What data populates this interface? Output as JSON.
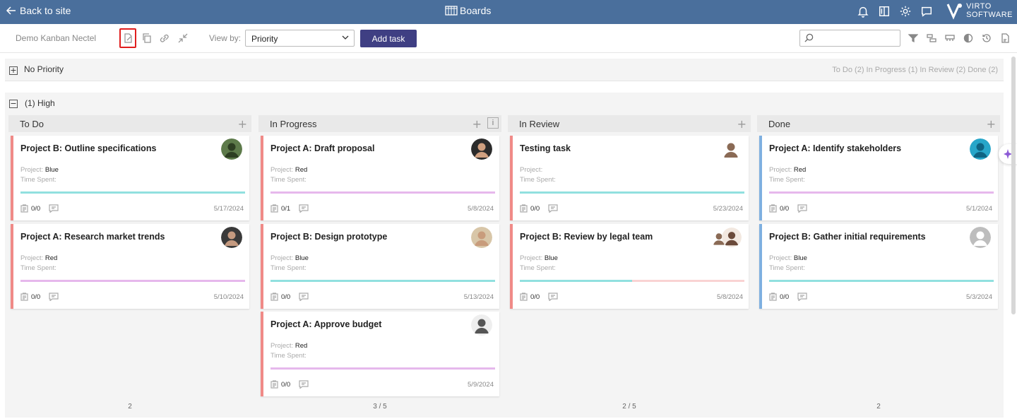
{
  "topbar": {
    "back_label": "Back to site",
    "title": "Boards",
    "icons": [
      "bell-icon",
      "book-icon",
      "gear-icon",
      "feedback-icon"
    ],
    "logo_line1": "VIRTO",
    "logo_line2": "SOFTWARE"
  },
  "toolbar": {
    "board_name": "Demo Kanban Nectel",
    "viewby_label": "View by:",
    "viewby_value": "Priority",
    "add_task_label": "Add task",
    "search_placeholder": ""
  },
  "lanes": [
    {
      "title": "No Priority",
      "summary": "To Do (2)  In Progress (1)  In Review (2)  Done (2)",
      "collapsed": true
    },
    {
      "title": "(1) High",
      "collapsed": false
    }
  ],
  "columns": [
    {
      "title": "To Do",
      "count": "2",
      "cards": [
        {
          "title": "Project B: Outline specifications",
          "project_label": "Project:",
          "project": "Blue",
          "time_label": "Time Spent:",
          "checklist": "0/0",
          "date": "5/17/2024"
        },
        {
          "title": "Project A: Research market trends",
          "project_label": "Project:",
          "project": "Red",
          "time_label": "Time Spent:",
          "checklist": "0/0",
          "date": "5/10/2024"
        }
      ]
    },
    {
      "title": "In Progress",
      "count": "3  /  5",
      "cards": [
        {
          "title": "Project A: Draft proposal",
          "project_label": "Project:",
          "project": "Red",
          "time_label": "Time Spent:",
          "checklist": "0/1",
          "date": "5/8/2024"
        },
        {
          "title": "Project B: Design prototype",
          "project_label": "Project:",
          "project": "Blue",
          "time_label": "Time Spent:",
          "checklist": "0/0",
          "date": "5/13/2024"
        },
        {
          "title": "Project A: Approve budget",
          "project_label": "Project:",
          "project": "Red",
          "time_label": "Time Spent:",
          "checklist": "0/0",
          "date": "5/9/2024"
        }
      ]
    },
    {
      "title": "In Review",
      "count": "2  /  5",
      "cards": [
        {
          "title": "Testing task",
          "project_label": "Project:",
          "project": "",
          "time_label": "Time Spent:",
          "checklist": "0/0",
          "date": "5/23/2024"
        },
        {
          "title": "Project B: Review by legal team",
          "project_label": "Project:",
          "project": "Blue",
          "time_label": "Time Spent:",
          "checklist": "0/0",
          "date": "5/8/2024",
          "progress": 0.5
        }
      ]
    },
    {
      "title": "Done",
      "count": "2",
      "cards": [
        {
          "title": "Project A: Identify stakeholders",
          "project_label": "Project:",
          "project": "Red",
          "time_label": "Time Spent:",
          "checklist": "0/0",
          "date": "5/1/2024"
        },
        {
          "title": "Project B: Gather initial requirements",
          "project_label": "Project:",
          "project": "Blue",
          "time_label": "Time Spent:",
          "checklist": "0/0",
          "date": "5/3/2024"
        }
      ]
    }
  ],
  "colors": {
    "topbar": "#4a6f9c",
    "button": "#3f3f83",
    "red_card": "#f08a87",
    "blue_card": "#7fb0e0",
    "progress_teal": "#91e0df",
    "progress_pink": "#e6b8ec"
  }
}
